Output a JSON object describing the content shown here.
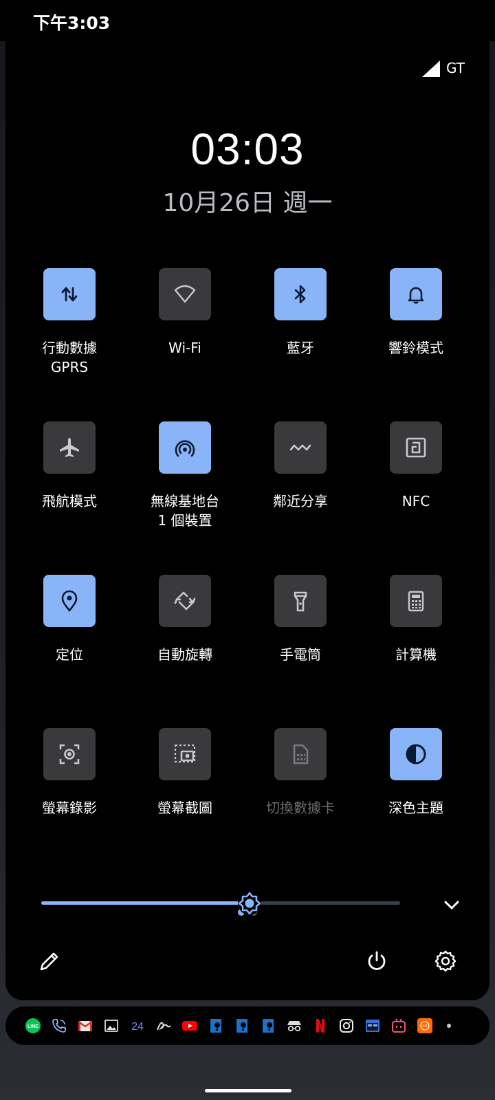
{
  "status_bar": {
    "time": "下午3:03",
    "carrier": "GT"
  },
  "lockclock": {
    "time": "03:03",
    "date": "10月26日 週一"
  },
  "tiles": [
    {
      "label": "行動數據",
      "sub": "GPRS",
      "state": "on",
      "icon": "mobile-data-icon"
    },
    {
      "label": "Wi-Fi",
      "sub": "",
      "state": "off",
      "icon": "wifi-icon"
    },
    {
      "label": "藍牙",
      "sub": "",
      "state": "on",
      "icon": "bluetooth-icon"
    },
    {
      "label": "響鈴模式",
      "sub": "",
      "state": "on",
      "icon": "bell-icon"
    },
    {
      "label": "飛航模式",
      "sub": "",
      "state": "off",
      "icon": "airplane-icon"
    },
    {
      "label": "無線基地台",
      "sub": "1 個裝置",
      "state": "on",
      "icon": "hotspot-icon"
    },
    {
      "label": "鄰近分享",
      "sub": "",
      "state": "off",
      "icon": "nearby-share-icon"
    },
    {
      "label": "NFC",
      "sub": "",
      "state": "off",
      "icon": "nfc-icon"
    },
    {
      "label": "定位",
      "sub": "",
      "state": "on",
      "icon": "location-icon"
    },
    {
      "label": "自動旋轉",
      "sub": "",
      "state": "off",
      "icon": "auto-rotate-icon"
    },
    {
      "label": "手電筒",
      "sub": "",
      "state": "off",
      "icon": "flashlight-icon"
    },
    {
      "label": "計算機",
      "sub": "",
      "state": "off",
      "icon": "calculator-icon"
    },
    {
      "label": "螢幕錄影",
      "sub": "",
      "state": "off",
      "icon": "screen-record-icon"
    },
    {
      "label": "螢幕截圖",
      "sub": "",
      "state": "off",
      "icon": "screenshot-icon"
    },
    {
      "label": "切換數據卡",
      "sub": "",
      "state": "disabled",
      "icon": "sim-card-icon"
    },
    {
      "label": "深色主題",
      "sub": "",
      "state": "on",
      "icon": "dark-theme-icon"
    }
  ],
  "pager": {
    "pages": 2,
    "current": 1
  },
  "brightness": {
    "level": 0.58
  },
  "controls": {
    "edit": "pencil-icon",
    "power": "power-icon",
    "settings": "gear-icon",
    "expand": "chevron-down-icon"
  },
  "notification_icons": [
    "line-icon",
    "phone-icon",
    "gmail-icon",
    "gallery-icon",
    "24-icon",
    "signature-icon",
    "youtube-icon",
    "app-icon",
    "app-icon",
    "app-icon",
    "incognito-icon",
    "netflix-icon",
    "instagram-icon",
    "calendar-icon",
    "bilibili-icon",
    "mi-icon"
  ],
  "colors": {
    "accent": "#8ab4f8",
    "tile_off": "#3a3a3c",
    "panel": "#000000"
  }
}
